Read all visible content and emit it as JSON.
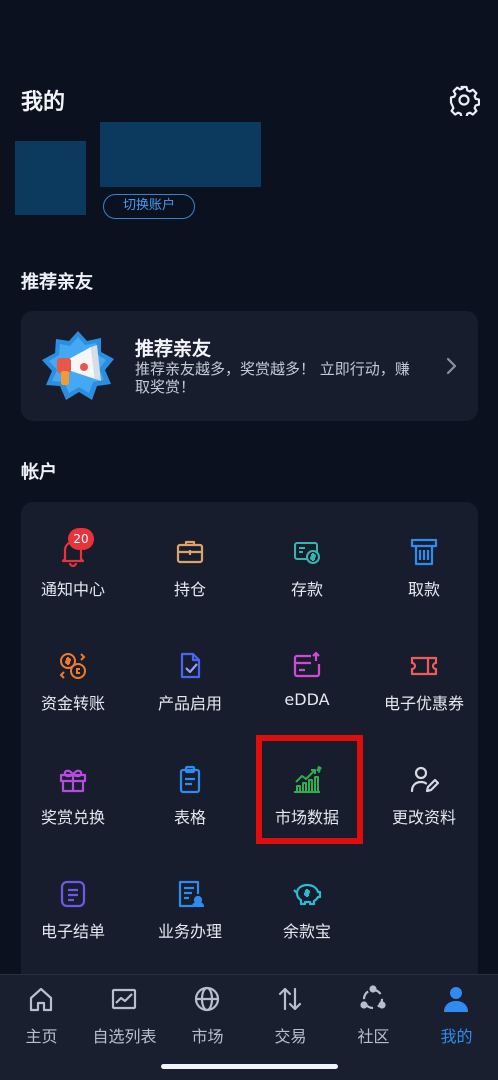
{
  "header": {
    "title": "我的",
    "switch_account_label": "切换账户"
  },
  "referral": {
    "section_title": "推荐亲友",
    "card_title": "推荐亲友",
    "card_desc": "推荐亲友越多，奖赏越多！ 立即行动，赚取奖赏！"
  },
  "account": {
    "section_title": "帐户",
    "notification_badge": "20",
    "items": [
      {
        "label": "通知中心",
        "icon": "bell-icon",
        "color": "#e8333b"
      },
      {
        "label": "持仓",
        "icon": "briefcase-icon",
        "color": "#d9a36a"
      },
      {
        "label": "存款",
        "icon": "deposit-icon",
        "color": "#38b4b0"
      },
      {
        "label": "取款",
        "icon": "atm-withdraw-icon",
        "color": "#2f8bef"
      },
      {
        "label": "资金转账",
        "icon": "currency-exchange-icon",
        "color": "#f07a2e"
      },
      {
        "label": "产品启用",
        "icon": "product-activate-icon",
        "color": "#4a66f0"
      },
      {
        "label": "eDDA",
        "icon": "edda-card-icon",
        "color": "#d04ad8"
      },
      {
        "label": "电子优惠券",
        "icon": "coupon-icon",
        "color": "#ef5b56"
      },
      {
        "label": "奖赏兑换",
        "icon": "gift-icon",
        "color": "#b54be0"
      },
      {
        "label": "表格",
        "icon": "clipboard-icon",
        "color": "#2f8bef"
      },
      {
        "label": "市场数据",
        "icon": "market-data-chart-icon",
        "color": "#2fae4f"
      },
      {
        "label": "更改资料",
        "icon": "edit-profile-icon",
        "color": "#d5d9e2"
      },
      {
        "label": "电子结单",
        "icon": "e-statement-icon",
        "color": "#6b5ae8"
      },
      {
        "label": "业务办理",
        "icon": "business-service-icon",
        "color": "#2f8bef"
      },
      {
        "label": "余款宝",
        "icon": "piggy-bank-icon",
        "color": "#2bbcd4"
      }
    ]
  },
  "tabbar": {
    "tabs": [
      {
        "label": "主页",
        "icon": "home-icon"
      },
      {
        "label": "自选列表",
        "icon": "watchlist-chart-icon"
      },
      {
        "label": "市场",
        "icon": "globe-icon"
      },
      {
        "label": "交易",
        "icon": "trade-arrows-icon"
      },
      {
        "label": "社区",
        "icon": "community-icon"
      },
      {
        "label": "我的",
        "icon": "profile-icon"
      }
    ],
    "active_color": "#2f8bef"
  }
}
